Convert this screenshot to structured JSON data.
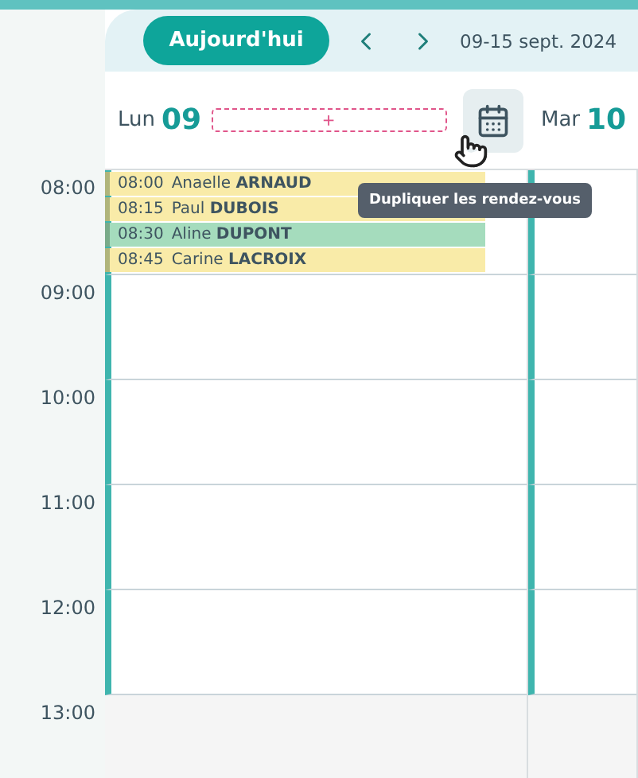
{
  "toolbar": {
    "today_button": "Aujourd'hui",
    "date_range": "09-15 sept. 2024"
  },
  "days": [
    {
      "weekday": "Lun",
      "day": "09",
      "add_slot": "+",
      "duplicate_tooltip": "Dupliquer les rendez-vous"
    },
    {
      "weekday": "Mar",
      "day": "10"
    }
  ],
  "hours": [
    {
      "label": "08:00",
      "open": true
    },
    {
      "label": "09:00",
      "open": true
    },
    {
      "label": "10:00",
      "open": true
    },
    {
      "label": "11:00",
      "open": true
    },
    {
      "label": "12:00",
      "open": true
    },
    {
      "label": "13:00",
      "open": false
    }
  ],
  "appointments": [
    {
      "time": "08:00",
      "first_name": "Anaelle",
      "last_name": "ARNAUD",
      "color": "#f9eba8"
    },
    {
      "time": "08:15",
      "first_name": "Paul",
      "last_name": "DUBOIS",
      "color": "#f9eba8"
    },
    {
      "time": "08:30",
      "first_name": "Aline",
      "last_name": "DUPONT",
      "color": "#a5dcbd"
    },
    {
      "time": "08:45",
      "first_name": "Carine",
      "last_name": "LACROIX",
      "color": "#f9eba8"
    }
  ]
}
